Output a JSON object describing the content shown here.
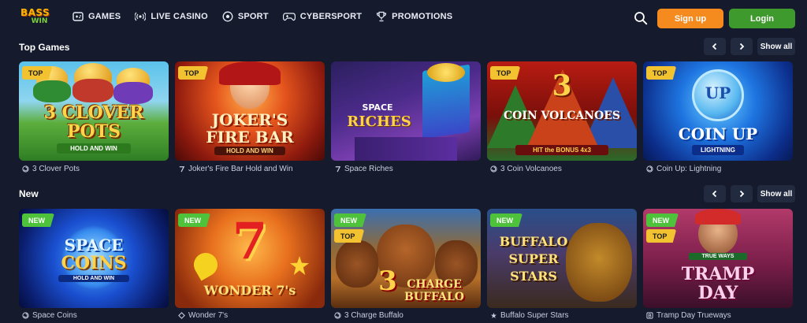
{
  "header": {
    "logo_line1": "BASS",
    "logo_line2": "WIN",
    "nav": [
      {
        "label": "GAMES",
        "icon": "gamepad-icon"
      },
      {
        "label": "LIVE CASINO",
        "icon": "broadcast-icon"
      },
      {
        "label": "SPORT",
        "icon": "soccer-ball-icon"
      },
      {
        "label": "CYBERSPORT",
        "icon": "controller-icon"
      },
      {
        "label": "PROMOTIONS",
        "icon": "trophy-icon"
      }
    ],
    "signup_label": "Sign up",
    "login_label": "Login",
    "accent_orange": "#f58a1f",
    "accent_green": "#3f9a2e"
  },
  "sections": [
    {
      "title": "Top Games",
      "show_all": "Show all",
      "games": [
        {
          "name": "3 Clover Pots",
          "badges": [
            "TOP"
          ],
          "art_line1": "3 CLOVER",
          "art_line2": "POTS",
          "art_line3": "HOLD AND WIN"
        },
        {
          "name": "Joker's Fire Bar Hold and Win",
          "badges": [
            "TOP"
          ],
          "art_line1": "JOKER'S",
          "art_line2": "FIRE BAR",
          "art_line3": "HOLD AND WIN"
        },
        {
          "name": "Space Riches",
          "badges": [],
          "art_line1": "SPACE",
          "art_line2": "RICHES",
          "art_line3": ""
        },
        {
          "name": "3 Coin Volcanoes",
          "badges": [
            "TOP"
          ],
          "art_line1": "3",
          "art_line2": "COIN VOLCANOES",
          "art_line3": "HIT the BONUS 4x3"
        },
        {
          "name": "Coin Up: Lightning",
          "badges": [
            "TOP"
          ],
          "art_line1": "UP",
          "art_line2": "COIN UP",
          "art_line3": "LIGHTNING"
        }
      ]
    },
    {
      "title": "New",
      "show_all": "Show all",
      "games": [
        {
          "name": "Space Coins",
          "badges": [
            "NEW"
          ],
          "art_line1": "SPACE",
          "art_line2": "COINS",
          "art_line3": "HOLD AND WIN"
        },
        {
          "name": "Wonder 7's",
          "badges": [
            "NEW"
          ],
          "art_line1": "7",
          "art_line2": "WONDER 7's",
          "art_line3": ""
        },
        {
          "name": "3 Charge Buffalo",
          "badges": [
            "NEW",
            "TOP"
          ],
          "art_line1": "3",
          "art_line2": "CHARGE",
          "art_line3": "BUFFALO"
        },
        {
          "name": "Buffalo Super Stars",
          "badges": [
            "NEW"
          ],
          "art_line1": "BUFFALO",
          "art_line2": "SUPER",
          "art_line3": "STARS"
        },
        {
          "name": "Tramp Day Trueways",
          "badges": [
            "NEW",
            "TOP"
          ],
          "art_line1": "TRUE WAYS",
          "art_line2": "TRAMP",
          "art_line3": "DAY"
        }
      ]
    }
  ]
}
